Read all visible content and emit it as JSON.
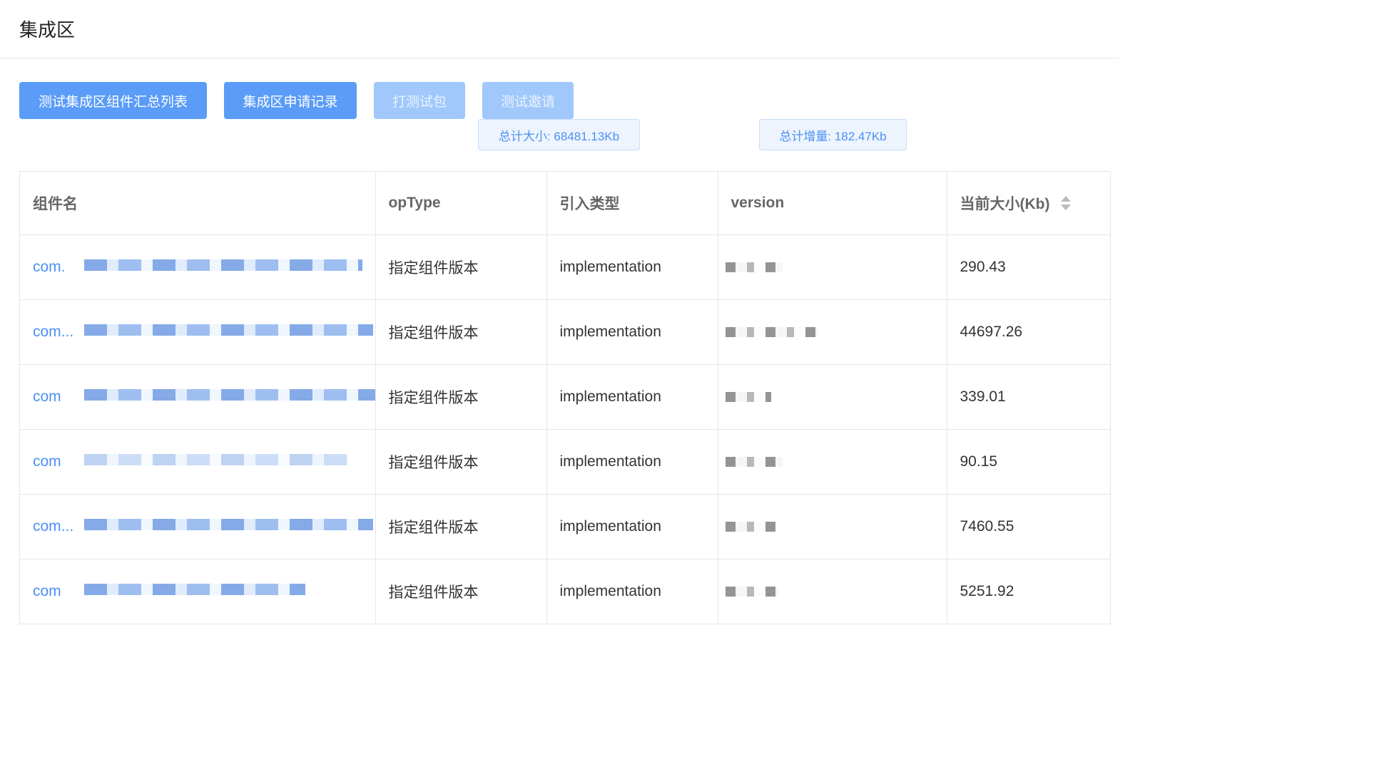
{
  "page": {
    "title": "集成区"
  },
  "toolbar": {
    "buttons": [
      {
        "label": "测试集成区组件汇总列表",
        "disabled": false
      },
      {
        "label": "集成区申请记录",
        "disabled": false
      },
      {
        "label": "打测试包",
        "disabled": true
      },
      {
        "label": "测试邀请",
        "disabled": true
      }
    ]
  },
  "summary": {
    "total_size": "总计大小: 68481.13Kb",
    "total_increase": "总计增量: 182.47Kb"
  },
  "table": {
    "headers": [
      "组件名",
      "opType",
      "引入类型",
      "version",
      "当前大小(Kb)"
    ],
    "rows": [
      {
        "name": "com.",
        "opType": "指定组件版本",
        "import_type": "implementation",
        "size": "290.43"
      },
      {
        "name": "com...",
        "opType": "指定组件版本",
        "import_type": "implementation",
        "size": "44697.26"
      },
      {
        "name": "com",
        "opType": "指定组件版本",
        "import_type": "implementation",
        "size": "339.01"
      },
      {
        "name": "com",
        "opType": "指定组件版本",
        "import_type": "implementation",
        "size": "90.15"
      },
      {
        "name": "com...",
        "opType": "指定组件版本",
        "import_type": "implementation",
        "size": "7460.55"
      },
      {
        "name": "com",
        "opType": "指定组件版本",
        "import_type": "implementation",
        "size": "5251.92"
      }
    ]
  },
  "colors": {
    "primary": "#5a9cf8",
    "primary_disabled": "#a0c8fb",
    "link": "#4d90f3"
  }
}
